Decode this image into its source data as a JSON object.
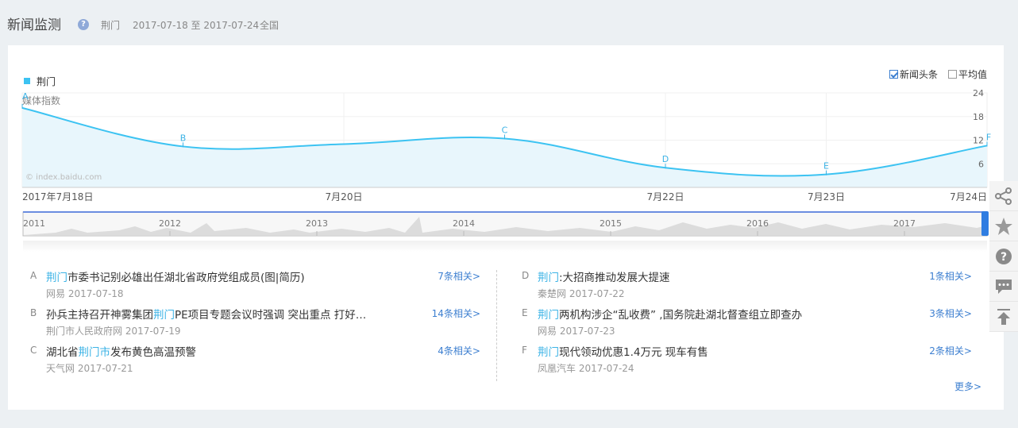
{
  "header": {
    "title": "新闻监测",
    "help_icon": "?",
    "keyword": "荆门",
    "date_range": "2017-07-18 至 2017-07-24",
    "region": "全国"
  },
  "legend": {
    "label": "荆门",
    "color": "#3cc3f2"
  },
  "options": {
    "headline": "新闻头条",
    "average": "平均值",
    "headline_checked": true,
    "average_checked": false
  },
  "chart_data": {
    "type": "area",
    "ylabel": "媒体指数",
    "watermark": "© index.baidu.com",
    "y_ticks": [
      "24",
      "18",
      "12",
      "6"
    ],
    "ylim": [
      0,
      24
    ],
    "x_labels": [
      "2017年7月18日",
      "7月20日",
      "7月22日",
      "7月23日",
      "7月24日"
    ],
    "x": [
      "2017-07-18",
      "2017-07-19",
      "2017-07-20",
      "2017-07-21",
      "2017-07-22",
      "2017-07-23",
      "2017-07-24"
    ],
    "series": [
      {
        "values": [
          20.2,
          10.4,
          11.0,
          12.4,
          5.0,
          3.3,
          10.6
        ]
      }
    ],
    "markers": [
      {
        "label": "A",
        "date": "2017-07-18"
      },
      {
        "label": "B",
        "date": "2017-07-19"
      },
      {
        "label": "C",
        "date": "2017-07-21"
      },
      {
        "label": "D",
        "date": "2017-07-22"
      },
      {
        "label": "E",
        "date": "2017-07-23"
      },
      {
        "label": "F",
        "date": "2017-07-24"
      }
    ],
    "timeline_years": [
      "2011",
      "2012",
      "2013",
      "2014",
      "2015",
      "2016",
      "2017"
    ],
    "color": "#3cc3f2"
  },
  "news_left": [
    {
      "letter": "A",
      "hl": "荆门",
      "title": "市委书记别必雄出任湖北省政府党组成员(图|简历)",
      "source": "网易 2017-07-18",
      "related": "7条相关>"
    },
    {
      "letter": "B",
      "pre": "孙兵主持召开神雾集团",
      "hl": "荆门",
      "title": "PE项目专题会议时强调 突出重点 打好…",
      "source": "荆门市人民政府网 2017-07-19",
      "related": "14条相关>"
    },
    {
      "letter": "C",
      "pre": "湖北省",
      "hl": "荆门市",
      "title": "发布黄色高温预警",
      "source": "天气网 2017-07-21",
      "related": "4条相关>"
    }
  ],
  "news_right": [
    {
      "letter": "D",
      "hl": "荆门",
      "title": ":大招商推动发展大提速",
      "source": "秦楚网 2017-07-22",
      "related": "1条相关>"
    },
    {
      "letter": "E",
      "hl": "荆门",
      "title": "两机构涉企“乱收费” ,国务院赴湖北督查组立即查办",
      "source": "网易 2017-07-23",
      "related": "3条相关>"
    },
    {
      "letter": "F",
      "hl": "荆门",
      "title": "现代领动优惠1.4万元 现车有售",
      "source": "凤凰汽车 2017-07-24",
      "related": "2条相关>"
    }
  ],
  "more": "更多>",
  "sidebar": [
    "share-icon",
    "star-icon",
    "help-icon",
    "comment-icon",
    "back-to-top-icon"
  ]
}
